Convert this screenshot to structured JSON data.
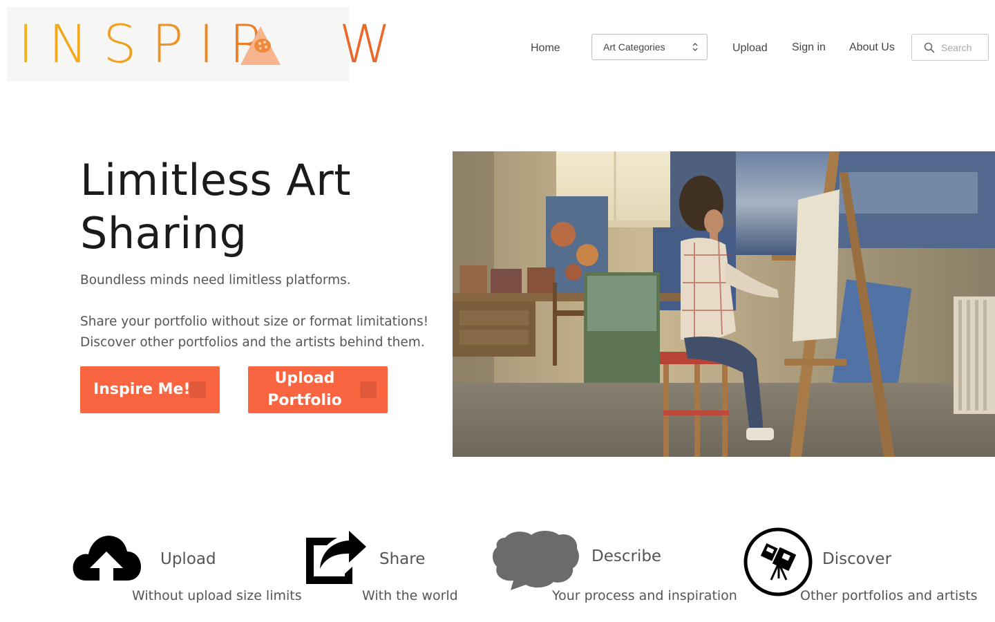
{
  "brand": {
    "name": "INSPIRAW",
    "letters": [
      "I",
      "N",
      "S",
      "P",
      "I",
      "R",
      "",
      "W"
    ],
    "letter_colors": [
      "#f2b21b",
      "#f1a81c",
      "#f09f1e",
      "#ef9320",
      "#ee8921",
      "#ec7d23",
      "",
      "#e9682a"
    ]
  },
  "nav": {
    "home": "Home",
    "categories_select": "Art Categories",
    "upload": "Upload",
    "sign_in": "Sign in",
    "about": "About Us",
    "search_placeholder": "Search"
  },
  "hero": {
    "title": "Limitless Art Sharing",
    "tagline": "Boundless minds need limitless platforms.",
    "description_line1": "Share your portfolio without size or format limitations!",
    "description_line2": "Discover other portfolios and the artists behind them.",
    "inspire_button": "Inspire Me!",
    "upload_button_line1": "Upload",
    "upload_button_line2": "Portfolio"
  },
  "features": [
    {
      "icon": "cloud-upload-icon",
      "title": "Upload",
      "subtitle": "Without upload size limits"
    },
    {
      "icon": "share-icon",
      "title": "Share",
      "subtitle": "With the world"
    },
    {
      "icon": "speech-cloud-icon",
      "title": "Describe",
      "subtitle": "Your process and inspiration"
    },
    {
      "icon": "telescope-icon",
      "title": "Discover",
      "subtitle": "Other portfolios and artists"
    }
  ],
  "colors": {
    "accent": "#f96541",
    "accent_dark": "#e0593a",
    "text_dark": "#1b1b1b",
    "text_muted": "#555555"
  }
}
